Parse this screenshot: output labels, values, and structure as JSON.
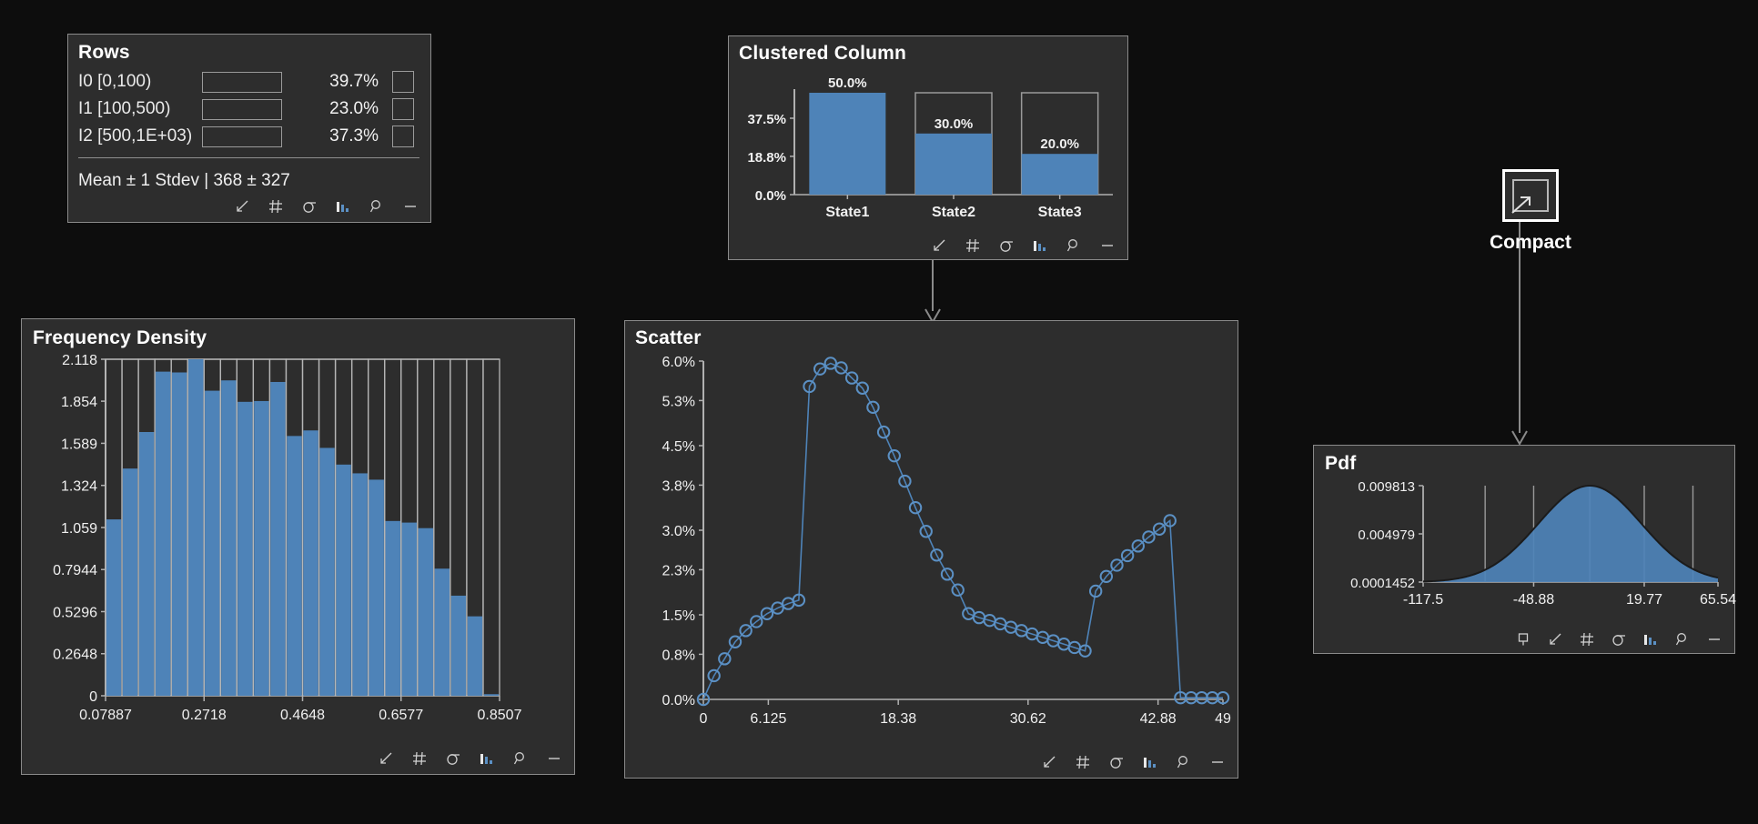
{
  "theme": {
    "background": "#0d0d0d",
    "panel_bg": "#2d2d2d",
    "panel_border": "#8a8a8a",
    "accent": "#4e83b8",
    "text": "#f0f0f0",
    "axis": "#b0b0b0"
  },
  "rows_panel": {
    "title": "Rows",
    "items": [
      {
        "label": "I0 [0,100)",
        "percent": "39.7%",
        "fill": 39.7,
        "checked": false
      },
      {
        "label": "I1 [100,500)",
        "percent": "23.0%",
        "fill": 23.0,
        "checked": false
      },
      {
        "label": "I2 [500,1E+03)",
        "percent": "37.3%",
        "fill": 37.3,
        "checked": false
      }
    ],
    "summary": "Mean ± 1 Stdev | 368 ± 327",
    "toolbar": [
      "collapse-icon",
      "grid-icon",
      "sigma-icon",
      "bar-chart-icon",
      "search-icon",
      "minimize-icon"
    ]
  },
  "clustered_column_panel": {
    "title": "Clustered Column",
    "toolbar": [
      "collapse-icon",
      "grid-icon",
      "sigma-icon",
      "bar-chart-icon",
      "search-icon",
      "minimize-icon"
    ],
    "chart_data": {
      "type": "bar",
      "title": "Clustered Column",
      "categories": [
        "State1",
        "State2",
        "State3"
      ],
      "values": [
        50.0,
        30.0,
        20.0
      ],
      "data_labels": [
        "50.0%",
        "30.0%",
        "20.0%"
      ],
      "yticks": [
        0.0,
        18.8,
        37.5
      ],
      "ytick_labels": [
        "0.0%",
        "18.8%",
        "37.5%"
      ],
      "ylim": [
        0,
        50
      ],
      "xlabel": "",
      "ylabel": "",
      "grid": false,
      "legend": "none"
    }
  },
  "frequency_density_panel": {
    "title": "Frequency Density",
    "toolbar": [
      "collapse-icon",
      "grid-icon",
      "sigma-icon",
      "bar-chart-icon",
      "search-icon",
      "minimize-icon"
    ],
    "chart_data": {
      "type": "bar",
      "title": "Frequency Density",
      "xlabel": "",
      "ylabel": "",
      "ylim": [
        0,
        2.118
      ],
      "yticks": [
        0,
        0.2648,
        0.5296,
        0.7944,
        1.059,
        1.324,
        1.589,
        1.854,
        2.118
      ],
      "ytick_labels": [
        "0",
        "0.2648",
        "0.5296",
        "0.7944",
        "1.059",
        "1.324",
        "1.589",
        "1.854",
        "2.118"
      ],
      "xlim": [
        0.07887,
        0.8507
      ],
      "xticks": [
        0.07887,
        0.2718,
        0.4648,
        0.6577,
        0.8507
      ],
      "xtick_labels": [
        "0.07887",
        "0.2718",
        "0.4648",
        "0.6577",
        "0.8507"
      ],
      "bin_count": 24,
      "values": [
        1.11,
        1.43,
        1.66,
        2.04,
        2.035,
        2.118,
        1.92,
        1.985,
        1.85,
        1.855,
        1.975,
        1.635,
        1.67,
        1.56,
        1.455,
        1.4,
        1.36,
        1.1,
        1.09,
        1.055,
        0.8,
        0.63,
        0.5,
        0.01
      ],
      "grid": false,
      "legend": "none"
    }
  },
  "scatter_panel": {
    "title": "Scatter",
    "toolbar": [
      "collapse-icon",
      "grid-icon",
      "sigma-icon",
      "bar-chart-icon",
      "search-icon",
      "minimize-icon"
    ],
    "chart_data": {
      "type": "line",
      "title": "Scatter",
      "xlabel": "",
      "ylabel": "",
      "ylim": [
        0,
        6.0
      ],
      "yticks": [
        0.0,
        0.8,
        1.5,
        2.3,
        3.0,
        3.8,
        4.5,
        5.3,
        6.0
      ],
      "ytick_labels": [
        "0.0%",
        "0.8%",
        "1.5%",
        "2.3%",
        "3.0%",
        "3.8%",
        "4.5%",
        "5.3%",
        "6.0%"
      ],
      "xlim": [
        0,
        49
      ],
      "xticks": [
        0,
        6.125,
        18.38,
        30.62,
        42.88,
        49
      ],
      "xtick_labels": [
        "0",
        "6.125",
        "18.38",
        "30.62",
        "42.88",
        "49"
      ],
      "marker": "open-circle",
      "x": [
        0,
        1,
        2,
        3,
        4,
        5,
        6,
        7,
        8,
        9,
        10,
        11,
        12,
        13,
        14,
        15,
        16,
        17,
        18,
        19,
        20,
        21,
        22,
        23,
        24,
        25,
        26,
        27,
        28,
        29,
        30,
        31,
        32,
        33,
        34,
        35,
        36,
        37,
        38,
        39,
        40,
        41,
        42,
        43,
        44,
        45,
        46,
        47,
        48,
        49
      ],
      "y": [
        0.0,
        0.42,
        0.72,
        1.02,
        1.22,
        1.38,
        1.52,
        1.62,
        1.7,
        1.76,
        5.55,
        5.86,
        5.96,
        5.88,
        5.7,
        5.52,
        5.18,
        4.74,
        4.32,
        3.87,
        3.4,
        2.98,
        2.56,
        2.22,
        1.94,
        1.52,
        1.45,
        1.4,
        1.34,
        1.28,
        1.22,
        1.16,
        1.1,
        1.04,
        0.98,
        0.92,
        0.86,
        1.92,
        2.18,
        2.38,
        2.55,
        2.72,
        2.88,
        3.02,
        3.17,
        0.03,
        0.03,
        0.03,
        0.03,
        0.03
      ],
      "grid": false,
      "legend": "none"
    }
  },
  "pdf_panel": {
    "title": "Pdf",
    "toolbar": [
      "pin-icon",
      "collapse-icon",
      "grid-icon",
      "sigma-icon",
      "bar-chart-icon",
      "search-icon",
      "minimize-icon"
    ],
    "chart_data": {
      "type": "area",
      "title": "Pdf",
      "xlabel": "",
      "ylabel": "",
      "ylim": [
        0.0001452,
        0.009813
      ],
      "yticks": [
        0.0001452,
        0.004979,
        0.009813
      ],
      "ytick_labels": [
        "0.0001452",
        "0.004979",
        "0.009813"
      ],
      "xlim": [
        -117.5,
        65.54
      ],
      "xticks": [
        -117.5,
        -48.88,
        19.77,
        65.54
      ],
      "xtick_labels": [
        "-117.5",
        "-48.88",
        "19.77",
        "65.54"
      ],
      "distribution": "normal",
      "mean": -14.0,
      "stdev": 32.0,
      "vertical_markers": [
        -117.5,
        -79.0,
        -48.88,
        -14.0,
        19.77,
        50.0
      ],
      "grid": false,
      "legend": "none"
    }
  },
  "compact_node": {
    "label": "Compact",
    "icon": "expand-window-icon"
  },
  "connectors": [
    {
      "from": "clustered-column-panel",
      "to": "scatter-panel"
    },
    {
      "from": "compact-node",
      "to": "pdf-panel"
    }
  ]
}
